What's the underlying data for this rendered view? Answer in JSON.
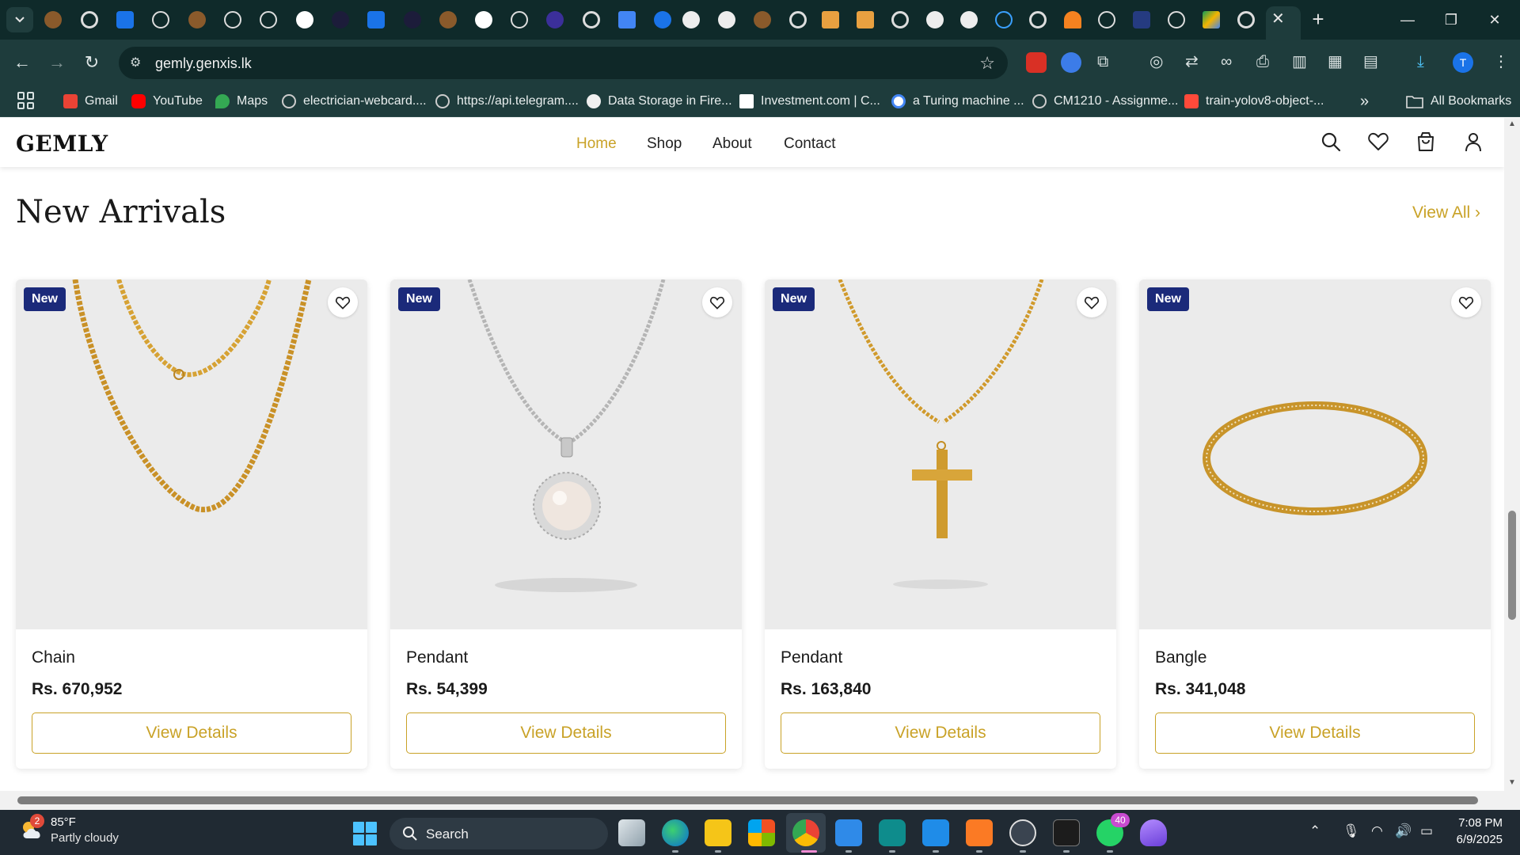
{
  "browser": {
    "url": "gemly.genxis.lk",
    "bookmarks": [
      {
        "label": "Gmail",
        "color": "#ea4335"
      },
      {
        "label": "YouTube",
        "color": "#ff0000"
      },
      {
        "label": "Maps",
        "color": "#34a853"
      },
      {
        "label": "electrician-webcard....",
        "color": "#9aa0a6"
      },
      {
        "label": "https://api.telegram....",
        "color": "#9aa0a6"
      },
      {
        "label": "Data Storage in Fire...",
        "color": "#ffffff"
      },
      {
        "label": "Investment.com | C...",
        "color": "#ffffff"
      },
      {
        "label": "a Turing machine ...",
        "color": "#4285f4"
      },
      {
        "label": "CM1210 - Assignme...",
        "color": "#9aa0a6"
      },
      {
        "label": "train-yolov8-object-...",
        "color": "#ff4a3a"
      }
    ],
    "all_bookmarks": "All Bookmarks",
    "overflow": "»",
    "profile_initial": "T"
  },
  "site": {
    "logo": "GEMLY",
    "nav": [
      "Home",
      "Shop",
      "About",
      "Contact"
    ],
    "accent": "#c9a227",
    "section_title": "New Arrivals",
    "view_all": "View All ›",
    "products": [
      {
        "badge": "New",
        "name": "Chain",
        "price": "Rs. 670,952",
        "button": "View Details",
        "image": "gold-chain"
      },
      {
        "badge": "New",
        "name": "Pendant",
        "price": "Rs. 54,399",
        "button": "View Details",
        "image": "silver-pearl-pendant"
      },
      {
        "badge": "New",
        "name": "Pendant",
        "price": "Rs. 163,840",
        "button": "View Details",
        "image": "gold-cross-pendant"
      },
      {
        "badge": "New",
        "name": "Bangle",
        "price": "Rs. 341,048",
        "button": "View Details",
        "image": "gold-bangle"
      }
    ]
  },
  "taskbar": {
    "weather_temp": "85°F",
    "weather_desc": "Partly cloudy",
    "weather_badge": "2",
    "search_label": "Search",
    "whatsapp_badge": "40",
    "time": "7:08 PM",
    "date": "6/9/2025"
  }
}
